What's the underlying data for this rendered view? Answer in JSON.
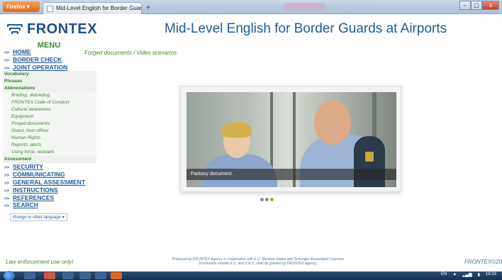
{
  "browser": {
    "app_button": "Firefox",
    "tab_title": "Mid-Level English for Border Guards at A...",
    "new_tab": "+",
    "minimize": "–",
    "maximize": "▢",
    "close": "x"
  },
  "header": {
    "logo_text": "FRONTEX",
    "page_title": "Mid-Level English for Border Guards at Airports"
  },
  "menu": {
    "title": "MENU",
    "top_items": [
      {
        "label": "HOME"
      },
      {
        "label": "BORDER CHECK"
      },
      {
        "label": "JOINT OPERATION"
      }
    ],
    "joint_sub": [
      "Vocabulary",
      "Phrases",
      "Abbreviations"
    ],
    "abbr_items": [
      "Briefing, debriefing",
      "FRONTEX Code of Conduct",
      "Cultural awareness",
      "Equipment",
      "Forged documents",
      "Guest, host officer",
      "Human Rights",
      "Reports, alerts",
      "Using force, restraint"
    ],
    "assessment": "Assessment",
    "bottom_items": [
      {
        "label": "SECURITY"
      },
      {
        "label": "COMMUNICATING"
      },
      {
        "label": "GENERAL ASSESSMENT"
      },
      {
        "label": "INSTRUCTIONS"
      },
      {
        "label": "REFERENCES"
      },
      {
        "label": "SEARCH"
      }
    ],
    "language_select": "change to other language"
  },
  "breadcrumb": "Forged documents / Video scenarios",
  "video": {
    "caption": "Fantasy document.",
    "slides_total": 3,
    "active_slide": 3
  },
  "footer": {
    "left": "Law enforcement use only!",
    "center_line1": "Produced by FRONTEX Agency in cooperation with E.U. Member States and Schengen Associated Countries",
    "center_line2": "Distribution outside E.U. and S.A.C. shall be granted by FRONTEX Agency.",
    "right": "FRONTEX©2012"
  },
  "taskbar": {
    "lang": "EN",
    "time": "18:33"
  },
  "colors": {
    "brand_blue": "#1d5b9c",
    "menu_green": "#3a8a2a",
    "active_dot": "#b8a21c"
  }
}
